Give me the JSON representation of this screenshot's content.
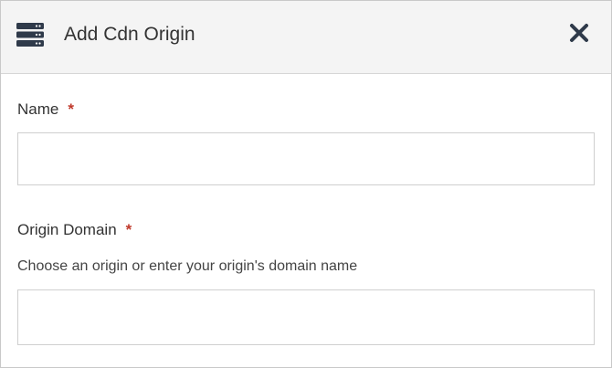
{
  "dialog": {
    "title": "Add Cdn Origin",
    "header_icon": "server-stack-icon",
    "close_icon": "close-icon"
  },
  "fields": {
    "name": {
      "label": "Name",
      "required_mark": "*",
      "value": "",
      "placeholder": ""
    },
    "origin_domain": {
      "label": "Origin Domain",
      "required_mark": "*",
      "help": "Choose an origin or enter your origin's domain name",
      "value": "",
      "placeholder": ""
    }
  },
  "colors": {
    "required": "#c0392b",
    "header_bg": "#f4f4f4",
    "icon": "#2f3a4a"
  }
}
